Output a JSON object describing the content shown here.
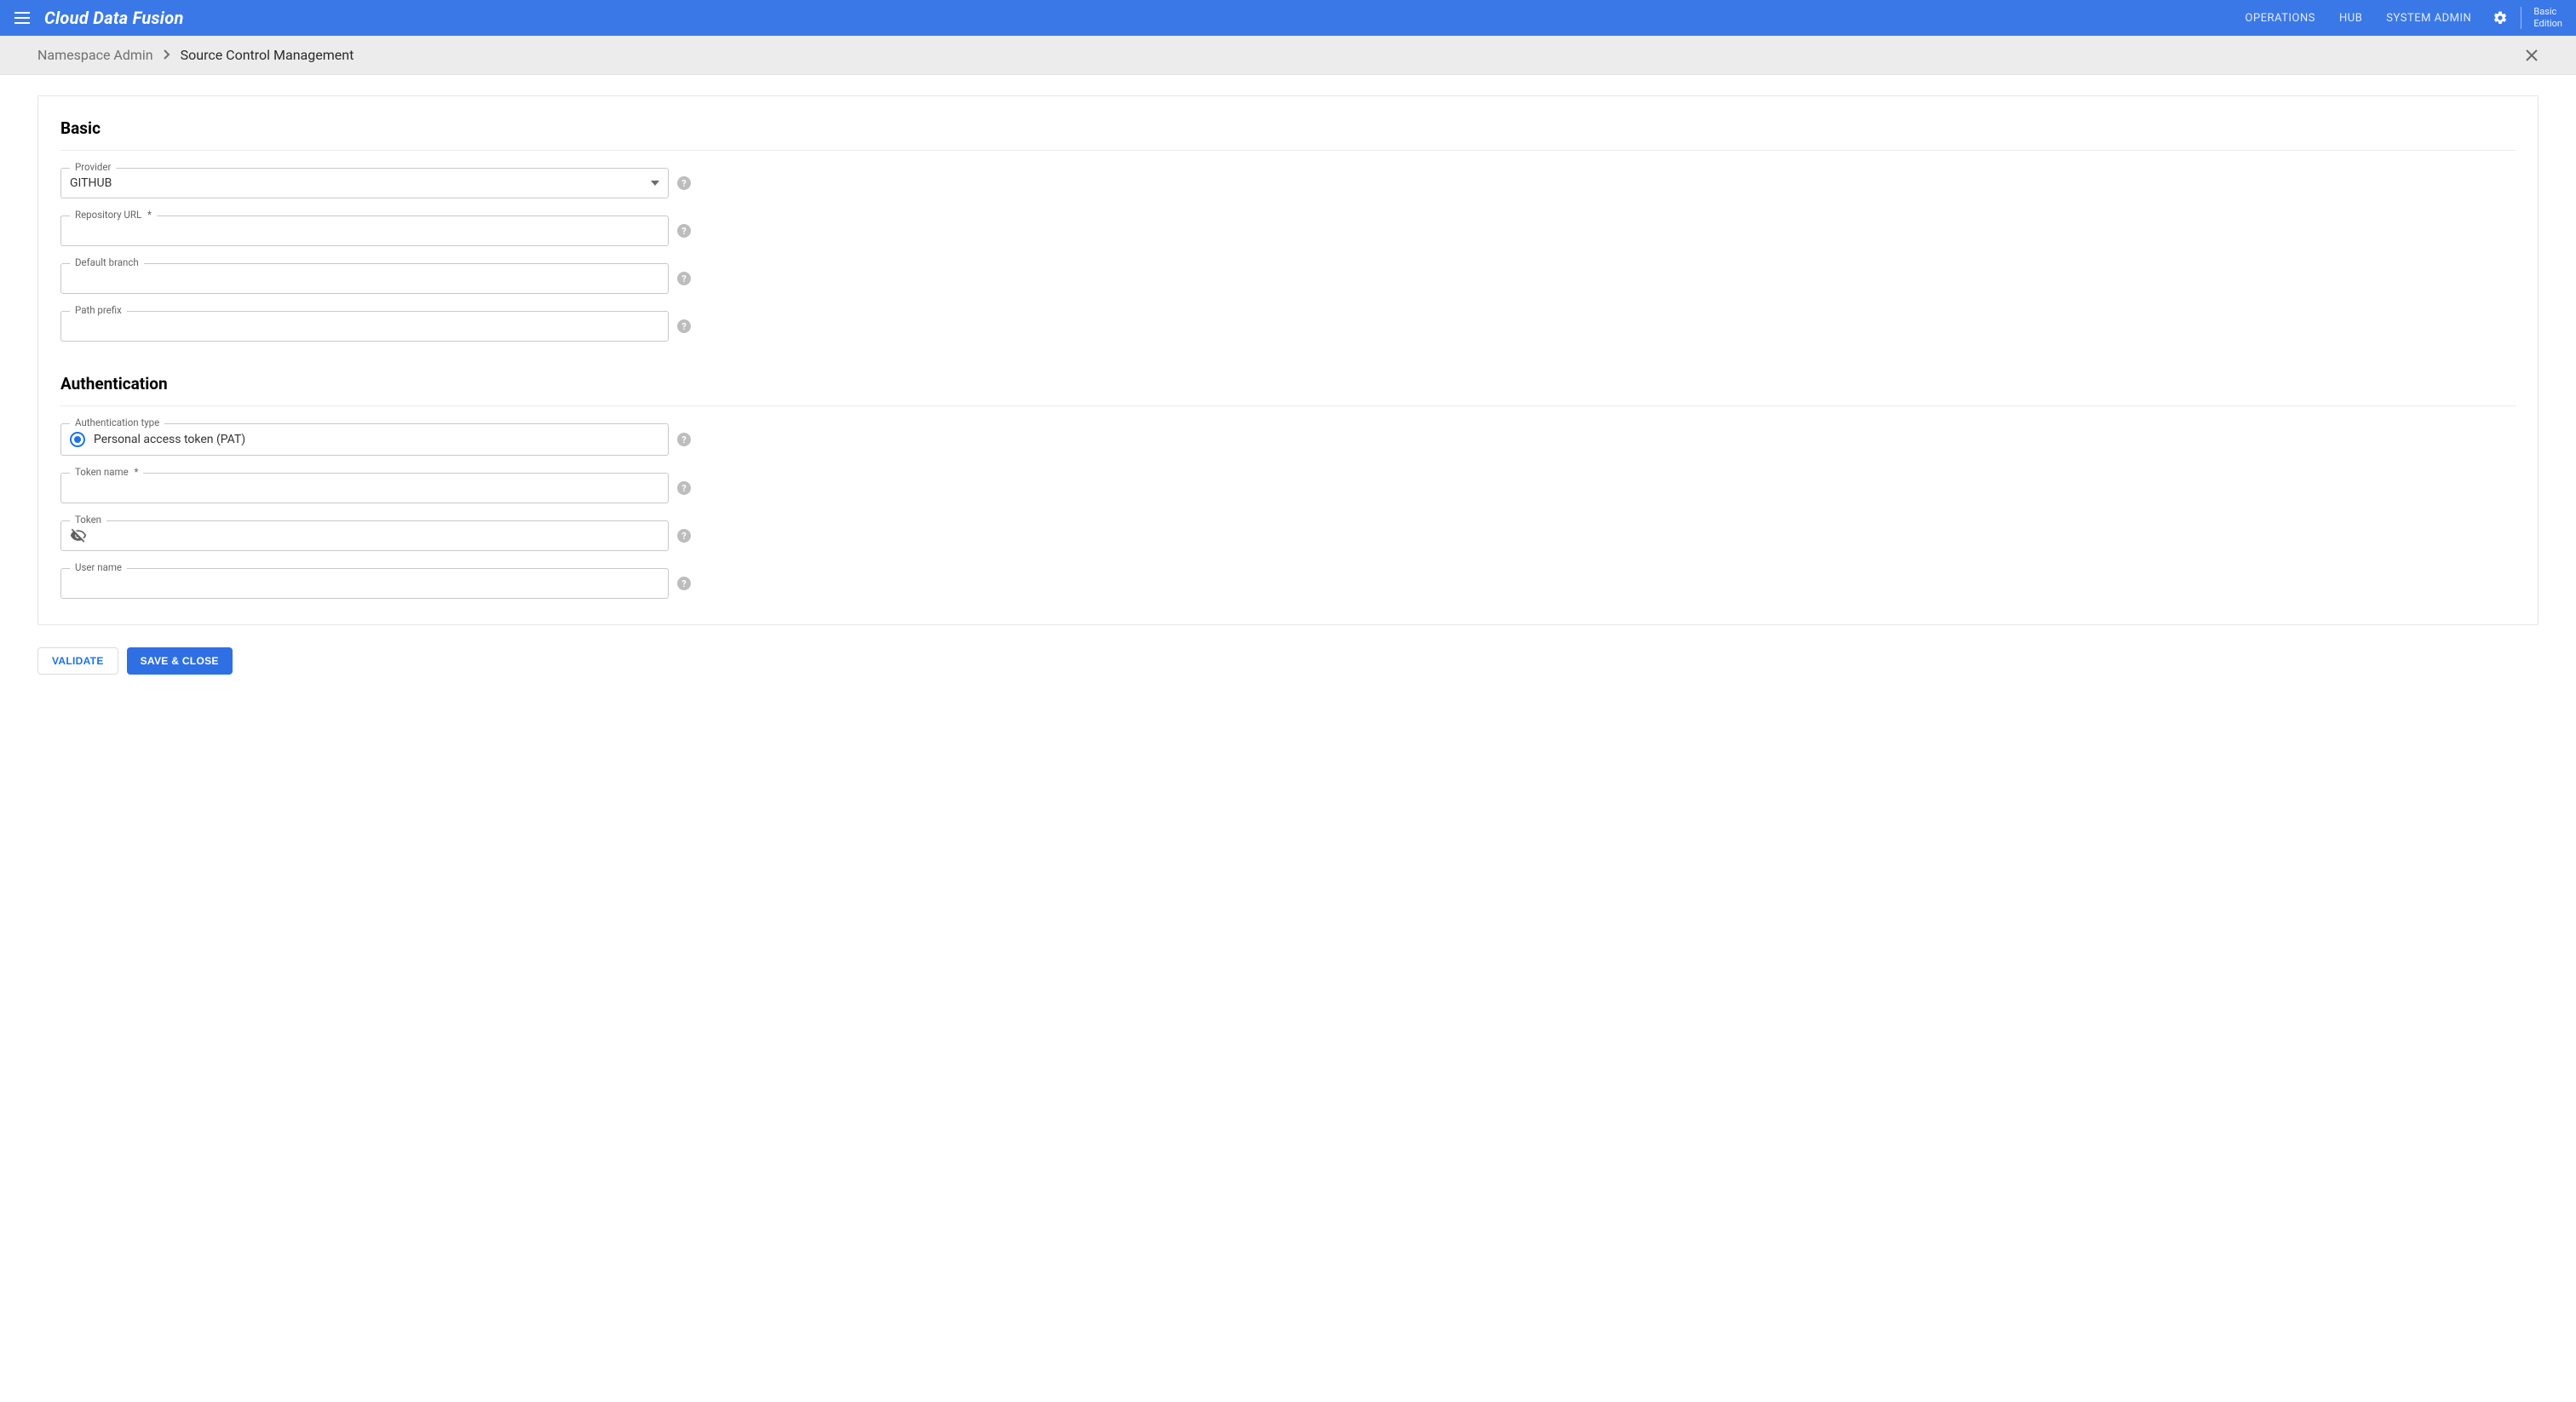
{
  "header": {
    "app_name": "Cloud Data Fusion",
    "nav": {
      "operations": "OPERATIONS",
      "hub": "HUB",
      "system_admin": "SYSTEM ADMIN"
    },
    "edition_line1": "Basic",
    "edition_line2": "Edition"
  },
  "breadcrumb": {
    "prev": "Namespace Admin",
    "current": "Source Control Management"
  },
  "sections": {
    "basic": {
      "title": "Basic",
      "provider": {
        "label": "Provider",
        "value": "GITHUB"
      },
      "repo_url": {
        "label": "Repository URL",
        "required_mark": "*",
        "value": ""
      },
      "default_branch": {
        "label": "Default branch",
        "value": ""
      },
      "path_prefix": {
        "label": "Path prefix",
        "value": ""
      }
    },
    "auth": {
      "title": "Authentication",
      "auth_type": {
        "label": "Authentication type",
        "option": "Personal access token (PAT)"
      },
      "token_name": {
        "label": "Token name",
        "required_mark": "*",
        "value": ""
      },
      "token": {
        "label": "Token",
        "value": ""
      },
      "user_name": {
        "label": "User name",
        "value": ""
      }
    }
  },
  "buttons": {
    "validate": "VALIDATE",
    "save_close": "SAVE & CLOSE"
  }
}
